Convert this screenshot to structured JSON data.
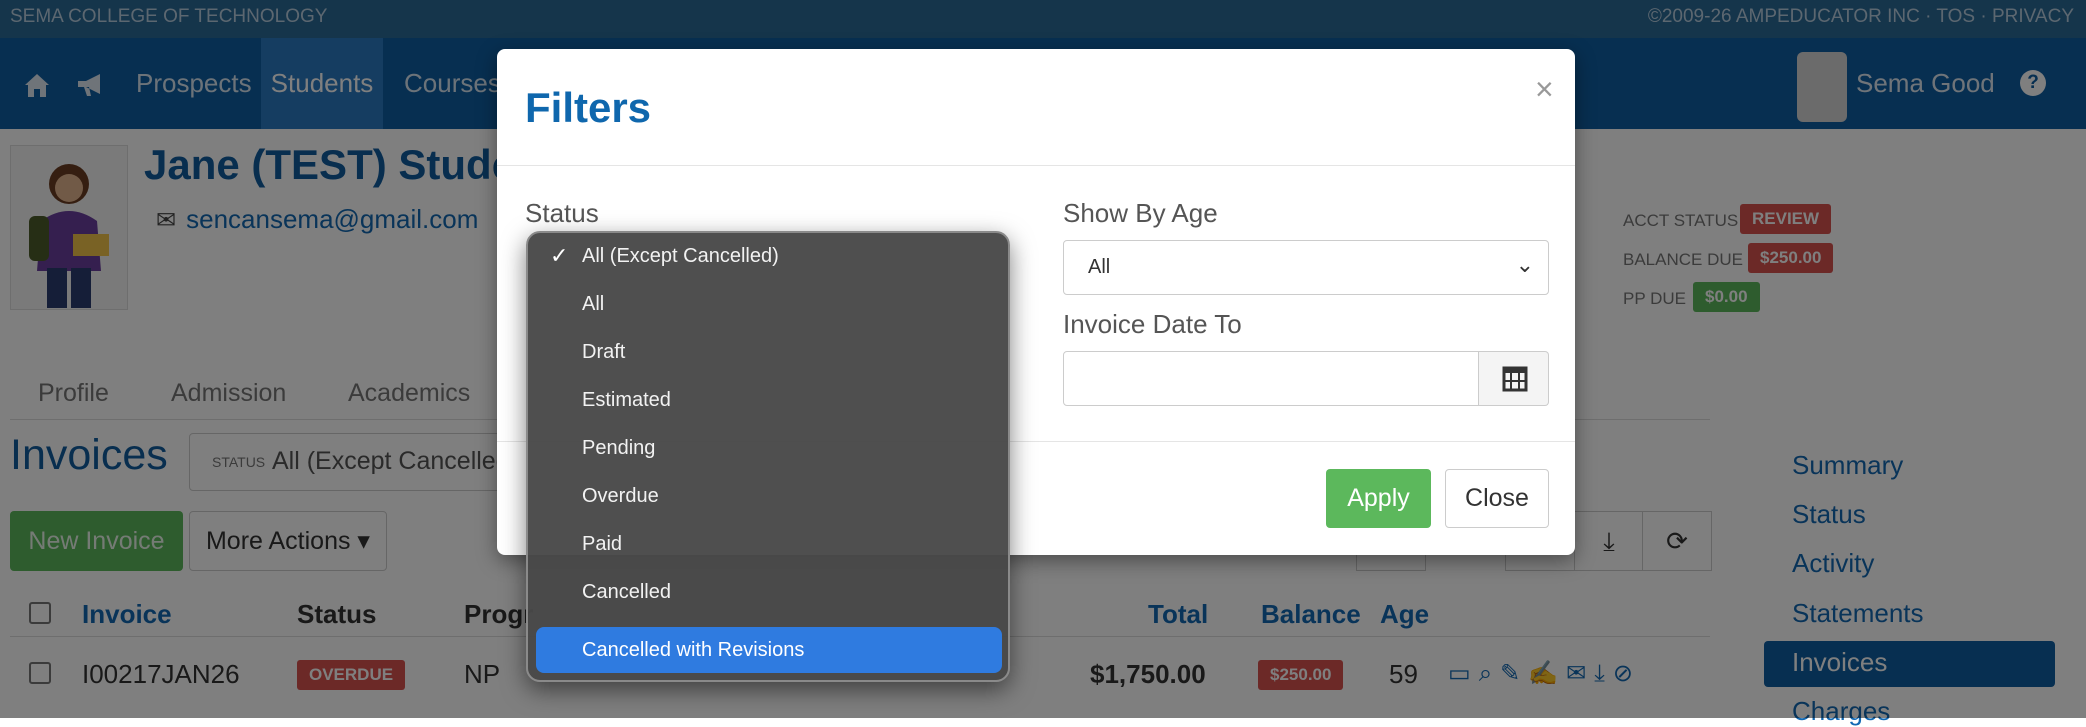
{
  "topbar": {
    "school": "SEMA COLLEGE OF TECHNOLOGY",
    "right": "©2009-26 AMPEDUCATOR INC · TOS · PRIVACY"
  },
  "nav": {
    "prospects": "Prospects",
    "students": "Students",
    "courses": "Courses",
    "username": "Sema Good",
    "help": "?"
  },
  "student": {
    "name": "Jane (TEST) Studen",
    "email": "sencansema@gmail.com"
  },
  "account": {
    "acct_status_label": "ACCT STATUS",
    "acct_status_value": "REVIEW",
    "balance_due_label": "BALANCE DUE",
    "balance_due_value": "$250.00",
    "pp_due_label": "PP DUE",
    "pp_due_value": "$0.00"
  },
  "tabs": [
    "Profile",
    "Admission",
    "Academics"
  ],
  "invoices": {
    "title": "Invoices",
    "status_filter_label": "STATUS",
    "status_filter_value": "All (Except Cancelled)",
    "new_invoice": "New Invoice",
    "more_actions": "More Actions ▾",
    "columns": {
      "invoice": "Invoice",
      "status": "Status",
      "program": "Progr",
      "total": "Total",
      "balance": "Balance",
      "age": "Age"
    },
    "rows": [
      {
        "invoice": "I00217JAN26",
        "status": "OVERDUE",
        "program": "NP",
        "total": "$1,750.00",
        "balance": "$250.00",
        "age": "59"
      }
    ]
  },
  "sidemenu": [
    "Summary",
    "Status",
    "Activity",
    "Statements",
    "Invoices",
    "Charges"
  ],
  "modal": {
    "title": "Filters",
    "close_x": "×",
    "status_label": "Status",
    "show_by_age_label": "Show By Age",
    "show_by_age_value": "All",
    "invoice_date_to_label": "Invoice Date To",
    "apply": "Apply",
    "close": "Close"
  },
  "dropdown": {
    "selected": "All (Except Cancelled)",
    "highlighted": "Cancelled with Revisions",
    "options": [
      "All (Except Cancelled)",
      "All",
      "Draft",
      "Estimated",
      "Pending",
      "Overdue",
      "Paid",
      "Cancelled",
      "Cancelled with Revisions"
    ]
  },
  "colors": {
    "nav": "#0f5fa3",
    "accent": "#0f67ad",
    "green": "#5cb85c",
    "red": "#d9534f",
    "dropdown_highlight": "#2f7be0"
  }
}
